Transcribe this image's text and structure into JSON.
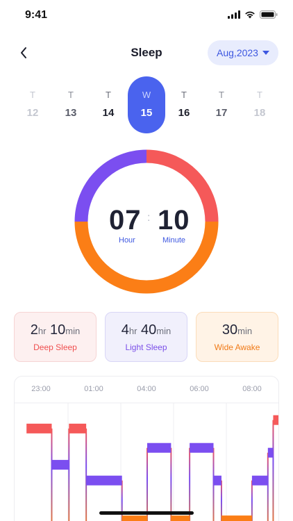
{
  "status_bar": {
    "time": "9:41"
  },
  "header": {
    "title": "Sleep",
    "month": "Aug,2023"
  },
  "days": [
    {
      "dow": "T",
      "num": "12",
      "state": "faded"
    },
    {
      "dow": "T",
      "num": "13",
      "state": "mid"
    },
    {
      "dow": "T",
      "num": "14",
      "state": "dark"
    },
    {
      "dow": "W",
      "num": "15",
      "state": "selected"
    },
    {
      "dow": "T",
      "num": "16",
      "state": "dark"
    },
    {
      "dow": "T",
      "num": "17",
      "state": "mid"
    },
    {
      "dow": "T",
      "num": "18",
      "state": "faded"
    }
  ],
  "summary": {
    "hours": "07",
    "minutes": "10",
    "hours_label": "Hour",
    "minutes_label": "Minute"
  },
  "ring_segments": [
    {
      "name": "Deep Sleep",
      "fraction": 0.25,
      "color": "#f55959"
    },
    {
      "name": "Wide Awake",
      "fraction": 0.5,
      "color": "#fb7e16"
    },
    {
      "name": "Light Sleep",
      "fraction": 0.25,
      "color": "#7b4ef0"
    }
  ],
  "stats": [
    {
      "h": "2",
      "h_unit": "hr",
      "m": "10",
      "m_unit": "min",
      "label": "Deep Sleep"
    },
    {
      "h": "4",
      "h_unit": "hr",
      "m": "40",
      "m_unit": "min",
      "label": "Light Sleep"
    },
    {
      "h": "",
      "h_unit": "",
      "m": "30",
      "m_unit": "min",
      "label": "Wide Awake"
    }
  ],
  "chart_data": {
    "type": "line",
    "x_ticks": [
      "23:00",
      "01:00",
      "04:00",
      "06:00",
      "08:00"
    ],
    "stages": [
      {
        "name": "Deep Sleep",
        "color": "#f55959"
      },
      {
        "name": "Light Sleep",
        "color": "#7b4ef0"
      },
      {
        "name": "Wide Awake",
        "color": "#fb7e16"
      }
    ],
    "segments": [
      {
        "start": 0.045,
        "end": 0.14,
        "stage": "Deep Sleep",
        "level": 0.88
      },
      {
        "start": 0.14,
        "end": 0.205,
        "stage": "Light Sleep",
        "level": 0.58
      },
      {
        "start": 0.205,
        "end": 0.27,
        "stage": "Deep Sleep",
        "level": 0.88
      },
      {
        "start": 0.27,
        "end": 0.405,
        "stage": "Light Sleep",
        "level": 0.45
      },
      {
        "start": 0.405,
        "end": 0.5,
        "stage": "Wide Awake",
        "level": 0.12
      },
      {
        "start": 0.5,
        "end": 0.59,
        "stage": "Light Sleep",
        "level": 0.72
      },
      {
        "start": 0.59,
        "end": 0.66,
        "stage": "Wide Awake",
        "level": 0.12
      },
      {
        "start": 0.66,
        "end": 0.75,
        "stage": "Light Sleep",
        "level": 0.72
      },
      {
        "start": 0.75,
        "end": 0.78,
        "stage": "Light Sleep",
        "level": 0.45
      },
      {
        "start": 0.78,
        "end": 0.895,
        "stage": "Wide Awake",
        "level": 0.12
      },
      {
        "start": 0.895,
        "end": 0.955,
        "stage": "Light Sleep",
        "level": 0.45
      },
      {
        "start": 0.955,
        "end": 0.975,
        "stage": "Light Sleep",
        "level": 0.68
      },
      {
        "start": 0.975,
        "end": 1.0,
        "stage": "Deep Sleep",
        "level": 0.95
      }
    ]
  }
}
